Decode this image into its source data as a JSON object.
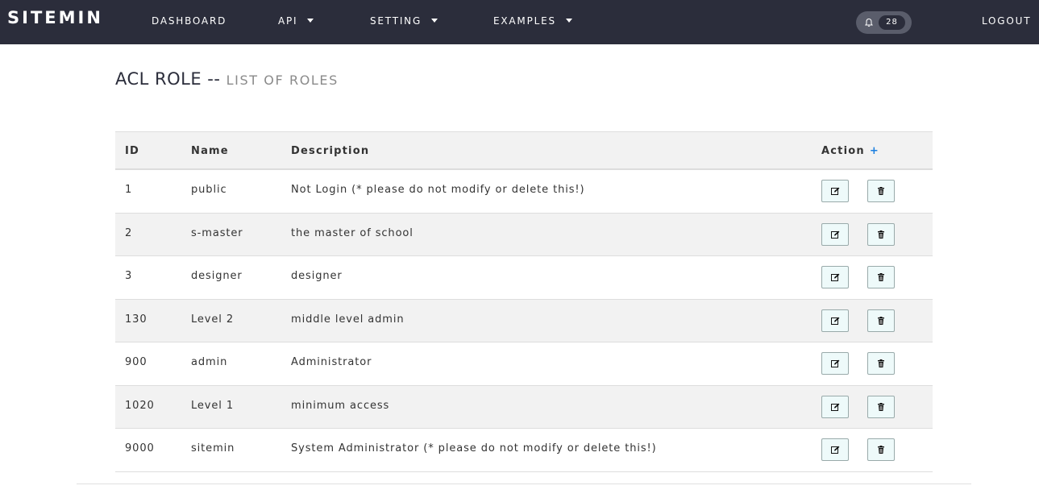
{
  "brand": "SITEMIN",
  "nav": {
    "dashboard": "DASHBOARD",
    "api": "API",
    "setting": "SETTING",
    "examples": "EXAMPLES",
    "logout": "LOGOUT"
  },
  "notifications": {
    "count": "28",
    "icon": "bell-icon"
  },
  "page": {
    "title": "ACL ROLE --",
    "subtitle": "LIST OF ROLES"
  },
  "table": {
    "headers": {
      "id": "ID",
      "name": "Name",
      "description": "Description",
      "action": "Action",
      "add": "+"
    },
    "rows": [
      {
        "id": "1",
        "name": "public",
        "description": "Not Login (* please do not modify or delete this!)"
      },
      {
        "id": "2",
        "name": "s-master",
        "description": "the master of school"
      },
      {
        "id": "3",
        "name": "designer",
        "description": "designer"
      },
      {
        "id": "130",
        "name": "Level 2",
        "description": "middle level admin"
      },
      {
        "id": "900",
        "name": "admin",
        "description": "Administrator"
      },
      {
        "id": "1020",
        "name": "Level 1",
        "description": "minimum access"
      },
      {
        "id": "9000",
        "name": "sitemin",
        "description": "System Administrator (* please do not modify or delete this!)"
      }
    ]
  },
  "colors": {
    "navbar": "#2b2d3b",
    "accent": "#1a7fe0",
    "row_alt": "#f2f2f2"
  }
}
